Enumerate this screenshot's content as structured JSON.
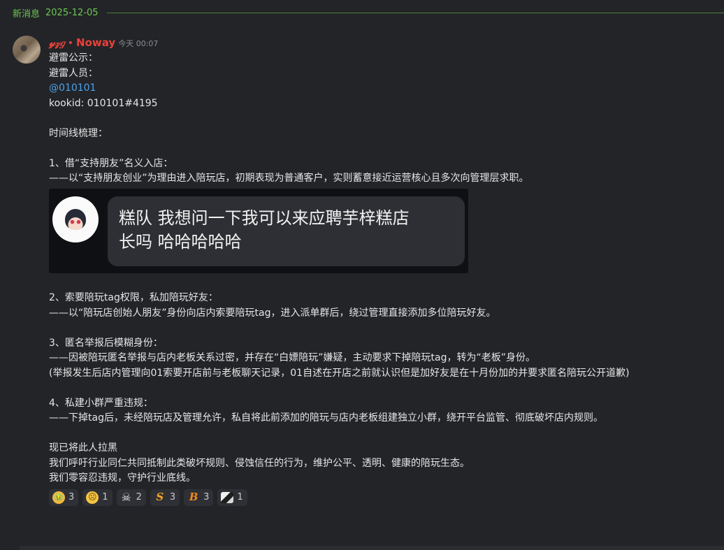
{
  "divider": {
    "label": "新消息",
    "date": "2025-12-05"
  },
  "message": {
    "author_part1": "𝓎𝓏𝑔",
    "author_dot": "•",
    "author_part2": "Noway",
    "timestamp": "今天 00:07",
    "lines": {
      "l1": "避雷公示：",
      "l2": "避雷人员：",
      "mention": "@010101",
      "l4": "kookid: 010101#4195",
      "l6": "时间线梳理：",
      "l8": "1、借“支持朋友”名义入店：",
      "l9": "——以“支持朋友创业”为理由进入陪玩店，初期表现为普通客户，实则蓄意接近运营核心且多次向管理层求职。",
      "l11": "2、索要陪玩tag权限，私加陪玩好友：",
      "l12": "——以“陪玩店创始人朋友”身份向店内索要陪玩tag，进入派单群后，绕过管理直接添加多位陪玩好友。",
      "l14": "3、匿名举报后模糊身份：",
      "l15": "——因被陪玩匿名举报与店内老板关系过密，并存在“白嫖陪玩”嫌疑，主动要求下掉陪玩tag，转为“老板”身份。",
      "l16": "(举报发生后店内管理向01索要开店前与老板聊天记录，01自述在开店之前就认识但是加好友是在十月份加的并要求匿名陪玩公开道歉)",
      "l18": "4、私建小群严重违规：",
      "l19": "——下掉tag后，未经陪玩店及管理允许，私自将此前添加的陪玩与店内老板组建独立小群，绕开平台监管、彻底破坏店内规则。",
      "l21": "现已将此人拉黑",
      "l22": "我们呼吁行业同仁共同抵制此类破坏规则、侵蚀信任的行为，维护公平、透明、健康的陪玩生态。",
      "l23": "我们零容忍违规，守护行业底线。"
    },
    "embedded_image": {
      "bubble_line1": "糕队 我想问一下我可以来应聘芋梓糕店",
      "bubble_line2": "长吗 哈哈哈哈哈"
    },
    "reactions": [
      {
        "icon": "nauseated-face-icon",
        "count": "3"
      },
      {
        "icon": "worried-face-icon",
        "count": "1"
      },
      {
        "icon": "skull-crossbones-icon",
        "count": "2"
      },
      {
        "icon": "letter-s-icon",
        "count": "3"
      },
      {
        "icon": "letter-b-icon",
        "count": "3"
      },
      {
        "icon": "custom-emoji-icon",
        "count": "1"
      }
    ]
  }
}
